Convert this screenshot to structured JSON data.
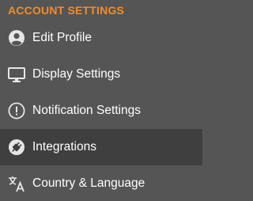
{
  "section": {
    "title": "ACCOUNT SETTINGS",
    "accent_color": "#f08c2e"
  },
  "menu": {
    "items": [
      {
        "label": "Edit Profile",
        "icon": "user-circle-icon",
        "active": false
      },
      {
        "label": "Display Settings",
        "icon": "monitor-icon",
        "active": false
      },
      {
        "label": "Notification Settings",
        "icon": "exclamation-circle-icon",
        "active": false
      },
      {
        "label": "Integrations",
        "icon": "plug-circle-icon",
        "active": true
      },
      {
        "label": "Country & Language",
        "icon": "translate-icon",
        "active": false
      }
    ]
  }
}
